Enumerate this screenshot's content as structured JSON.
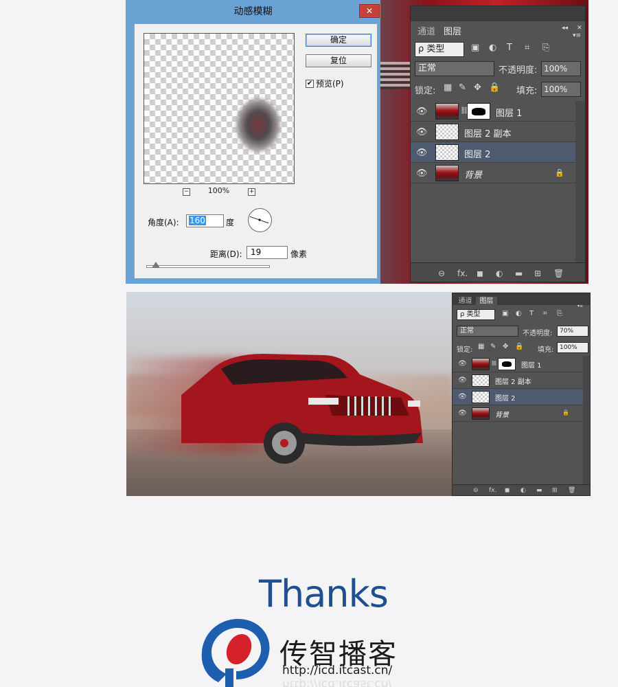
{
  "dialog": {
    "title": "动感模糊",
    "close": "✕",
    "ok": "确定",
    "reset": "复位",
    "preview_label": "预览(P)",
    "preview_checked": "✔",
    "zoom_minus": "−",
    "zoom_plus": "+",
    "zoom": "100%",
    "angle_label": "角度(A):",
    "angle_value": "160",
    "angle_unit": "度",
    "distance_label": "距离(D):",
    "distance_value": "19",
    "distance_unit": "像素",
    "distance_slider_fraction": 0.08
  },
  "panel1": {
    "tabs": [
      "通道",
      "图层"
    ],
    "active_tab": 1,
    "collapse": "◂◂",
    "close": "✕",
    "menu": "▾≡",
    "filter_kind": "ρ 类型",
    "filter_icons": [
      "▣",
      "◐",
      "T",
      "⌗",
      "⎘"
    ],
    "blend_mode": "正常",
    "opacity_label": "不透明度:",
    "opacity_value": "100%",
    "lock_label": "锁定:",
    "lock_icons": [
      "▦",
      "✎",
      "✥",
      "🔒"
    ],
    "fill_label": "填充:",
    "fill_value": "100%",
    "layers": [
      {
        "name": "图层 1",
        "thumb": "car",
        "has_mask": true,
        "selected": false,
        "locked": false
      },
      {
        "name": "图层 2 副本",
        "thumb": "trans",
        "has_mask": false,
        "selected": false,
        "locked": false
      },
      {
        "name": "图层 2",
        "thumb": "trans",
        "has_mask": false,
        "selected": true,
        "locked": false
      },
      {
        "name": "背景",
        "thumb": "car",
        "has_mask": false,
        "selected": false,
        "locked": true
      }
    ],
    "footer_icons": [
      "⊖",
      "fx.",
      "◼",
      "◐",
      "▬",
      "⊞",
      "🗑"
    ]
  },
  "panel2": {
    "tabs": [
      "通道",
      "图层"
    ],
    "active_tab": 1,
    "menu": "▾≡",
    "filter_kind": "ρ 类型",
    "filter_icons": [
      "▣",
      "◐",
      "T",
      "⌗",
      "⎘"
    ],
    "blend_mode": "正常",
    "opacity_label": "不透明度:",
    "opacity_value": "70%",
    "lock_label": "锁定:",
    "lock_icons": [
      "▦",
      "✎",
      "✥",
      "🔒"
    ],
    "fill_label": "填充:",
    "fill_value": "100%",
    "layers": [
      {
        "name": "图层 1",
        "thumb": "car",
        "has_mask": true,
        "selected": false,
        "locked": false
      },
      {
        "name": "图层 2 副本",
        "thumb": "trans",
        "has_mask": false,
        "selected": false,
        "locked": false
      },
      {
        "name": "图层 2",
        "thumb": "trans",
        "has_mask": false,
        "selected": true,
        "locked": false
      },
      {
        "name": "背景",
        "thumb": "car",
        "has_mask": false,
        "selected": false,
        "locked": true
      }
    ],
    "footer_icons": [
      "⊖",
      "fx.",
      "◼",
      "◐",
      "▬",
      "⊞",
      "🗑"
    ]
  },
  "thanks": {
    "title": "Thanks",
    "brand": "传智播客",
    "url": "http://icd.itcast.cn/"
  },
  "colors": {
    "brand_blue": "#1f4f8f",
    "logo_red": "#d5222a",
    "selected_layer": "#4e5a6e"
  }
}
